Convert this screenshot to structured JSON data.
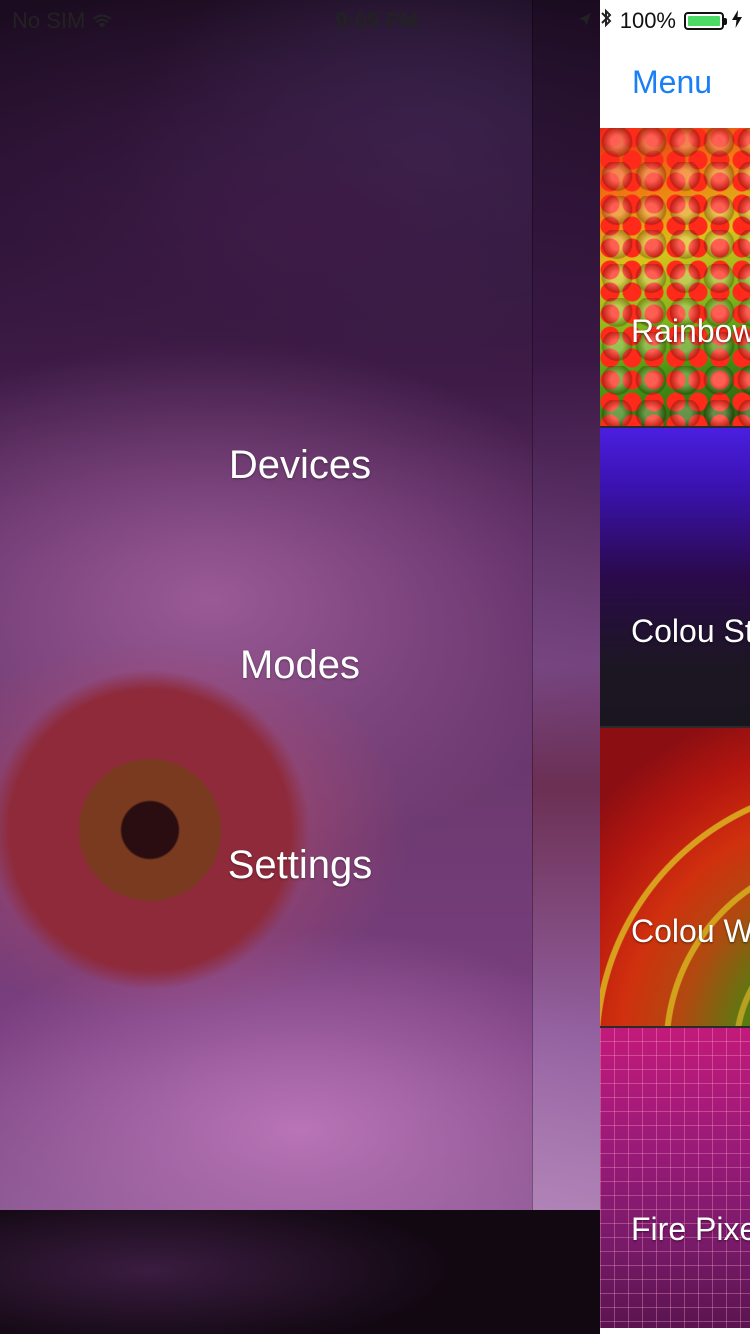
{
  "status_bar": {
    "carrier": "No SIM",
    "time": "9:09 PM",
    "battery_percent": "100%",
    "battery_level": 1.0
  },
  "side_menu": {
    "items": [
      {
        "label": "Devices"
      },
      {
        "label": "Modes"
      },
      {
        "label": "Settings"
      }
    ]
  },
  "panel": {
    "nav_title": "Menu",
    "modes": [
      {
        "label": "Rainbow"
      },
      {
        "label": "Colou St"
      },
      {
        "label": "Colou W"
      },
      {
        "label": "Fire Pixe"
      }
    ]
  },
  "colors": {
    "accent": "#1a7ef5",
    "battery_green": "#4cd964"
  }
}
